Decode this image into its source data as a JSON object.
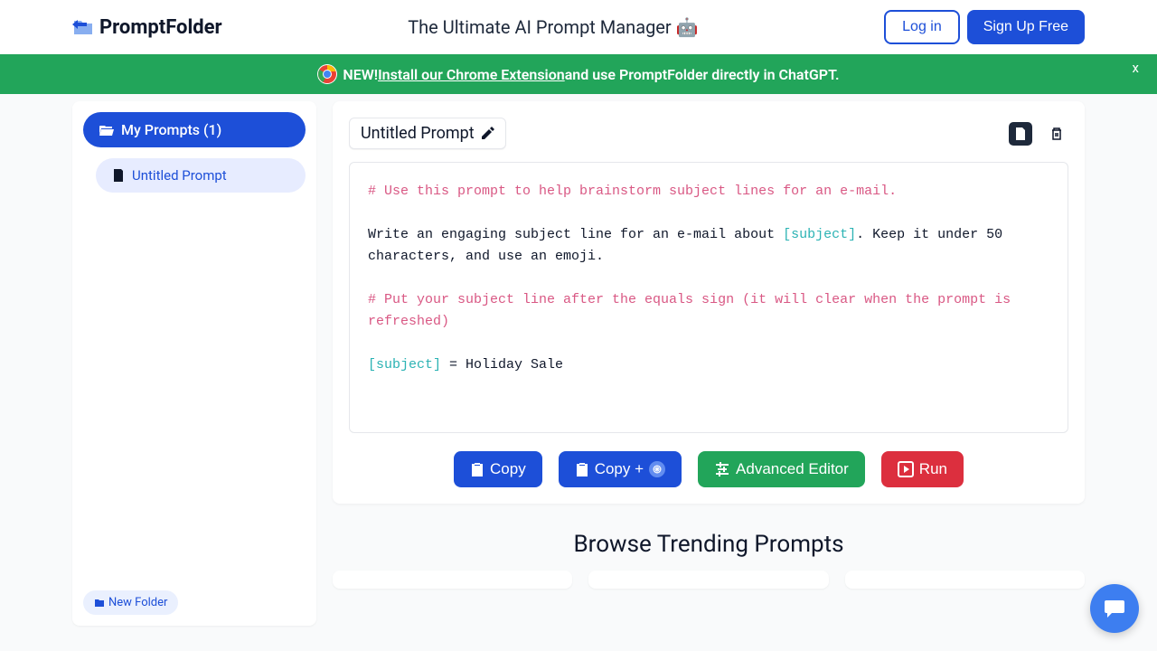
{
  "header": {
    "brand": "PromptFolder",
    "tagline": "The Ultimate AI Prompt Manager 🤖",
    "login": "Log in",
    "signup": "Sign Up Free"
  },
  "banner": {
    "new": "NEW! ",
    "link": "Install our Chrome Extension",
    "rest": " and use PromptFolder directly in ChatGPT.",
    "close": "x"
  },
  "sidebar": {
    "my_prompts": "My Prompts (1)",
    "item": "Untitled Prompt",
    "new_folder": "New Folder"
  },
  "editor": {
    "title": "Untitled Prompt",
    "comment1": "# Use this prompt to help brainstorm subject lines for an e-mail.",
    "line1a": "Write an engaging subject line for an e-mail about ",
    "line1_var": "[subject]",
    "line1b": ". Keep it under 50 characters, and use an emoji.",
    "comment2": "# Put your subject line after the equals sign (it will clear when the prompt is refreshed)",
    "line2_var": "[subject]",
    "line2_rest": " = Holiday Sale"
  },
  "actions": {
    "copy": "Copy",
    "copy_plus": "Copy + ",
    "advanced": "Advanced Editor",
    "run": "Run"
  },
  "trending": {
    "title": "Browse Trending Prompts"
  }
}
